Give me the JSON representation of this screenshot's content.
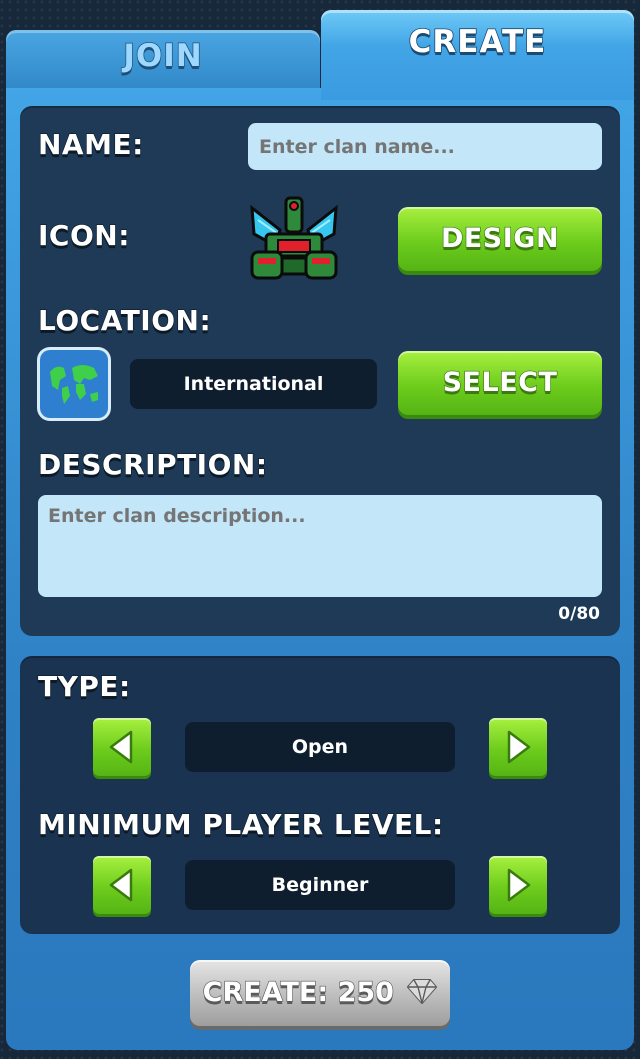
{
  "tabs": {
    "join": "JOIN",
    "create": "CREATE"
  },
  "form": {
    "name_label": "NAME:",
    "name_placeholder": "Enter clan name...",
    "icon_label": "ICON:",
    "design_button": "DESIGN",
    "location_label": "LOCATION:",
    "location_value": "International",
    "select_button": "SELECT",
    "description_label": "DESCRIPTION:",
    "description_placeholder": "Enter clan description...",
    "description_counter": "0/80"
  },
  "settings": {
    "type_label": "TYPE:",
    "type_value": "Open",
    "min_level_label": "MINIMUM PLAYER LEVEL:",
    "min_level_value": "Beginner"
  },
  "create_button": {
    "label": "CREATE: 250",
    "currency_icon": "gem-icon"
  },
  "colors": {
    "accent_green": "#6dcc1c",
    "tab_blue": "#42a5e6",
    "panel": "#1e3a56"
  }
}
